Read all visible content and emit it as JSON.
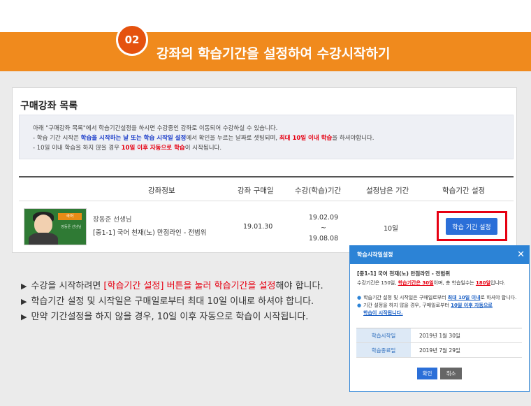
{
  "banner": {
    "step": "02",
    "title": "강좌의 학습기간을 설정하여 수강시작하기"
  },
  "panel": {
    "title": "구매강좌 목록",
    "notice": {
      "line1": "아래 \"구매강좌 목록\"에서 학습기간설정을 하시면 수강중인 강좌로 이동되어 수강하실 수 있습니다.",
      "line2_a": "- 학습 기간 시작은 ",
      "line2_b": "학습을 시작하는 날 또는 학습 시작일 설정",
      "line2_c": "에서 확인을 누르는 날짜로 셋팅되며, ",
      "line2_d": "최대 10일 이내 학습",
      "line2_e": "을 하셔야합니다.",
      "line3_a": "- 10일 이내 학습을 하지 않을 경우 ",
      "line3_b": "10일 이후 자동으로 학습",
      "line3_c": "이 시작됩니다."
    },
    "table": {
      "headers": [
        "강좌정보",
        "강좌 구매일",
        "수강(학습)기간",
        "설정남은 기간",
        "학습기간 설정"
      ],
      "row": {
        "thumb_tag": "국어",
        "thumb_sub": "장동준 선생님",
        "teacher": "장동준 선생님",
        "course": "[중1-1] 국어 천재(노) 만점라인 - 전범위",
        "purchase_date": "19.01.30",
        "period_start": "19.02.09",
        "period_sep": "~",
        "period_end": "19.08.08",
        "remaining": "10일",
        "button": "학습 기간 설정"
      }
    }
  },
  "bullets": {
    "b1_a": "수강을 시작하려면 ",
    "b1_b": "[학습기간 설정] 버튼을 눌러 학습기간을 설정",
    "b1_c": "해야 합니다.",
    "b2": "학습기간 설정 및 시작일은 구매일로부터 최대 10일 이내로 하셔야 합니다.",
    "b3": "만약 기간설정을 하지 않을 경우, 10일 이후 자동으로 학습이 시작됩니다.",
    "marker": "▶"
  },
  "popup": {
    "title": "학습시작일설정",
    "close": "✕",
    "course": "[중1-1] 국어 천재(노) 만점라인 - 전범위",
    "summary_a": "수강기간은 150일, ",
    "summary_b": "학습기간은 30일",
    "summary_c": "이며, 총 학습일수는 ",
    "summary_d": "180일",
    "summary_e": "입니다.",
    "note1_a": "학습기간 설정 및 시작일은 구매일로부터 ",
    "note1_b": "최대 10일 이내",
    "note1_c": "로 하셔야 합니다.",
    "note2_a": "기간 설정을 하지 않을 경우, 구매일로부터 ",
    "note2_b": "10일 이후 자동으로",
    "note2_c": "학습이 시작됩니다.",
    "rows": [
      {
        "label": "학습시작일",
        "value": "2019년 1월 30일"
      },
      {
        "label": "학습종료일",
        "value": "2019년 7월 29일"
      }
    ],
    "ok": "확인",
    "cancel": "취소"
  }
}
